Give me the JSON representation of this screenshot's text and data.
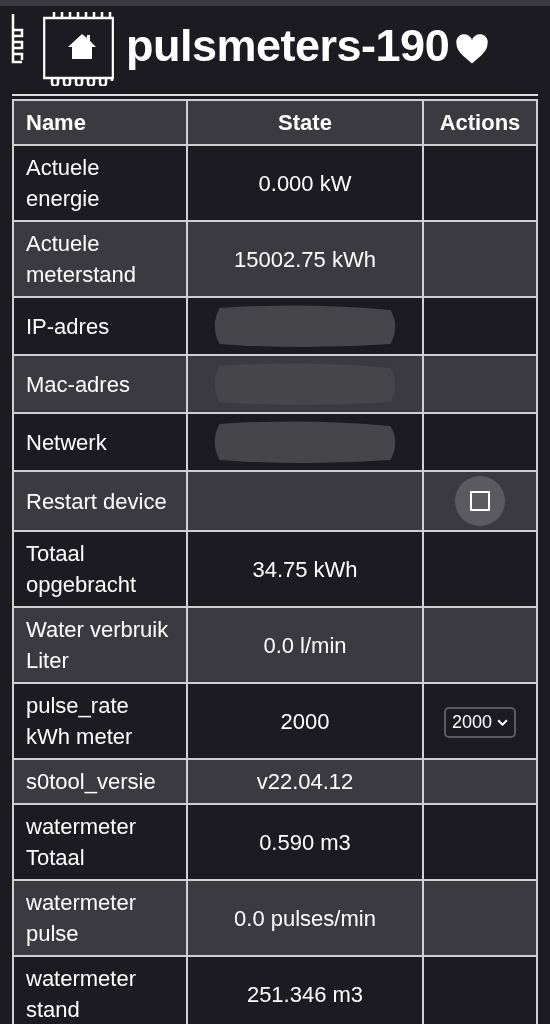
{
  "header": {
    "title": "pulsmeters-190"
  },
  "table": {
    "columns": [
      "Name",
      "State",
      "Actions"
    ],
    "rows": [
      {
        "name": "Actuele energie",
        "state": "0.000 kW"
      },
      {
        "name": "Actuele meterstand",
        "state": "15002.75 kWh"
      },
      {
        "name": "IP-adres",
        "redacted": true
      },
      {
        "name": "Mac-adres",
        "redacted": true
      },
      {
        "name": "Netwerk",
        "redacted": true
      },
      {
        "name": "Restart device",
        "action": {
          "kind": "button"
        }
      },
      {
        "name": "Totaal opgebracht",
        "state": "34.75 kWh"
      },
      {
        "name": "Water verbruik Liter",
        "state": "0.0 l/min"
      },
      {
        "name": "pulse_rate kWh meter",
        "state": "2000",
        "action": {
          "kind": "select",
          "value": "2000"
        }
      },
      {
        "name": "s0tool_versie",
        "state": "v22.04.12"
      },
      {
        "name": "watermeter Totaal",
        "state": "0.590 m3"
      },
      {
        "name": "watermeter pulse",
        "state": "0.0 pulses/min"
      },
      {
        "name": "watermeter stand",
        "state": "251.346 m3"
      }
    ]
  }
}
